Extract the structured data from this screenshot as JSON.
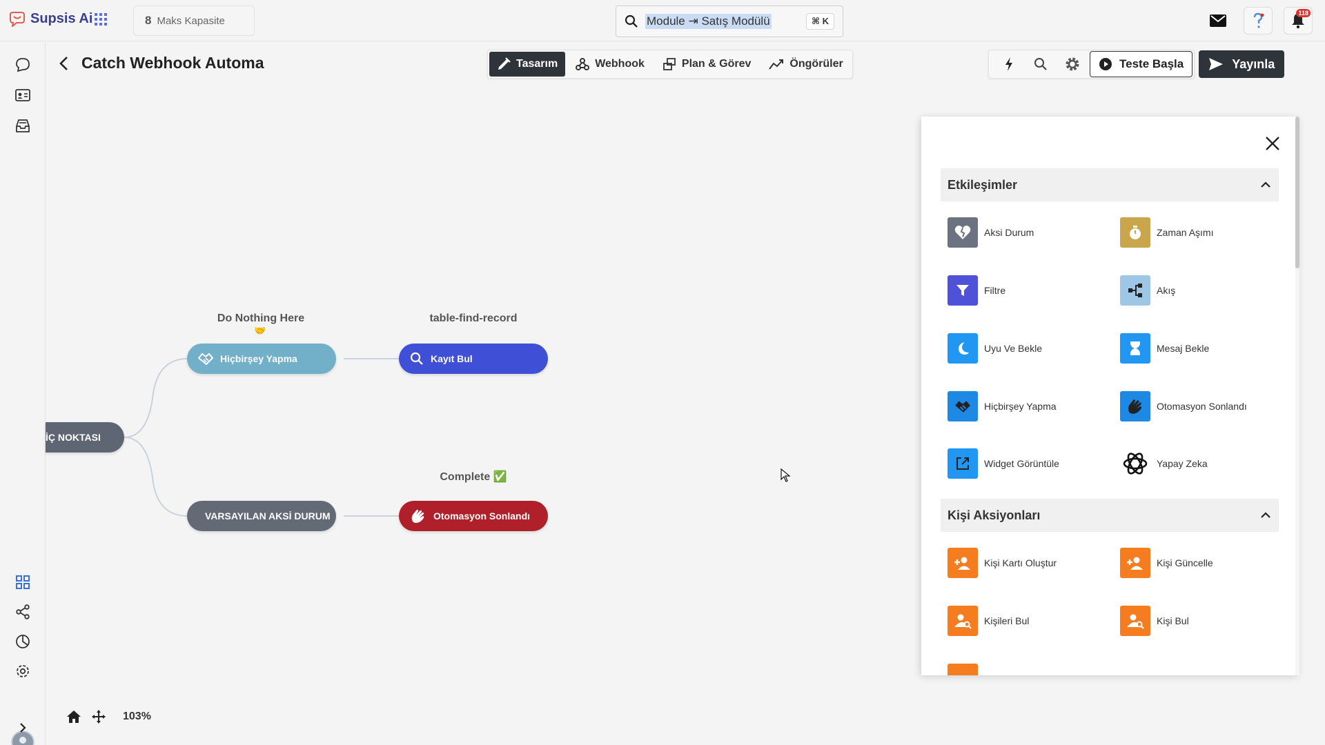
{
  "brand": {
    "name": "Supsis Ai",
    "color": "#3b3f8f"
  },
  "capacity": {
    "value": "8",
    "label": "Maks Kapasite"
  },
  "search": {
    "query": "Module ⇥ Satış Modülü",
    "shortcut": "⌘ K"
  },
  "notifications": {
    "count": "118"
  },
  "header": {
    "title": "Catch Webhook Automa",
    "tabs": [
      {
        "label": "Tasarım",
        "icon": "design-icon",
        "active": true
      },
      {
        "label": "Webhook",
        "icon": "webhook-icon",
        "active": false
      },
      {
        "label": "Plan & Görev",
        "icon": "plan-icon",
        "active": false
      },
      {
        "label": "Öngörüler",
        "icon": "insights-icon",
        "active": false
      }
    ],
    "test_label": "Teste Başla",
    "publish_label": "Yayınla"
  },
  "canvas": {
    "start_node": "İÇ NOKTASI",
    "nodes": [
      {
        "label": "Hiçbirşey Yapma",
        "caption": "Do Nothing Here",
        "color": "#72afc8",
        "icon": "handshake-icon"
      },
      {
        "label": "Kayıt Bul",
        "caption": "table-find-record",
        "color": "#3f4fd6",
        "icon": "search-icon"
      },
      {
        "label": "VARSAYILAN AKSİ DURUM",
        "caption": "",
        "color": "#636a76",
        "icon": "broken-heart-icon"
      },
      {
        "label": "Otomasyon Sonlandı",
        "caption": "Complete ✅",
        "color": "#b0202a",
        "icon": "clap-icon"
      }
    ],
    "zoom": "103%"
  },
  "panel": {
    "sections": [
      {
        "title": "Etkileşimler",
        "items": [
          {
            "label": "Aksi Durum",
            "icon": "broken-heart-icon",
            "color": "#6b7280"
          },
          {
            "label": "Zaman Aşımı",
            "icon": "timer-icon",
            "color": "#c9a64b"
          },
          {
            "label": "Filtre",
            "icon": "filter-icon",
            "color": "#4f52d8"
          },
          {
            "label": "Akış",
            "icon": "flow-icon",
            "color": "#9ec6e6"
          },
          {
            "label": "Uyu Ve Bekle",
            "icon": "moon-icon",
            "color": "#2196f3"
          },
          {
            "label": "Mesaj Bekle",
            "icon": "hourglass-icon",
            "color": "#2196f3"
          },
          {
            "label": "Hiçbirşey Yapma",
            "icon": "handshake-icon",
            "color": "#1e88e5"
          },
          {
            "label": "Otomasyon Sonlandı",
            "icon": "clap-icon",
            "color": "#1e88e5"
          },
          {
            "label": "Widget Görüntüle",
            "icon": "external-link-icon",
            "color": "#2196f3"
          },
          {
            "label": "Yapay Zeka",
            "icon": "openai-icon",
            "color": "#ffffff"
          }
        ]
      },
      {
        "title": "Kişi Aksiyonları",
        "items": [
          {
            "label": "Kişi Kartı Oluştur",
            "icon": "person-add-icon",
            "color": "#f57c1f"
          },
          {
            "label": "Kişi Güncelle",
            "icon": "person-add-icon",
            "color": "#f57c1f"
          },
          {
            "label": "Kişileri Bul",
            "icon": "person-search-icon",
            "color": "#f57c1f"
          },
          {
            "label": "Kişi Bul",
            "icon": "person-search-icon",
            "color": "#f57c1f"
          }
        ]
      }
    ]
  }
}
